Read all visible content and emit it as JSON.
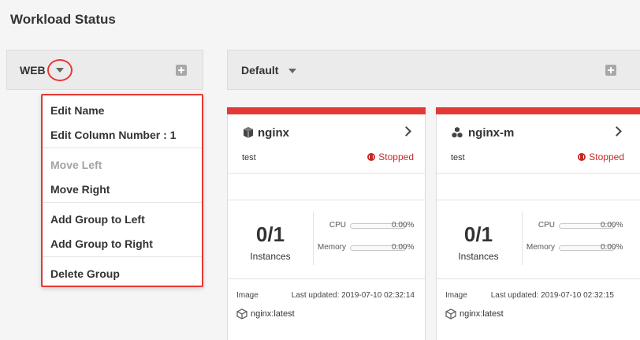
{
  "page": {
    "title": "Workload Status"
  },
  "groups": [
    {
      "name": "WEB"
    },
    {
      "name": "Default"
    }
  ],
  "menu": {
    "items": [
      {
        "label": "Edit Name",
        "disabled": false
      },
      {
        "label": "Edit Column Number : 1",
        "disabled": false
      },
      {
        "label": "Move Left",
        "disabled": true
      },
      {
        "label": "Move Right",
        "disabled": false
      },
      {
        "label": "Add Group to Left",
        "disabled": false
      },
      {
        "label": "Add Group to Right",
        "disabled": false
      },
      {
        "label": "Delete Group",
        "disabled": false
      }
    ]
  },
  "workloads": [
    {
      "name": "nginx",
      "icon": "cube-icon",
      "description": "test",
      "status": "Stopped",
      "instances": "0/1",
      "instances_label": "Instances",
      "cpu_label": "CPU",
      "cpu_value": "0.00%",
      "cpu_fraction": 0,
      "memory_label": "Memory",
      "memory_value": "0.00%",
      "memory_fraction": 0,
      "image_label": "Image",
      "last_updated": "Last updated: 2019-07-10 02:32:14",
      "image_name": "nginx:latest"
    },
    {
      "name": "nginx-m",
      "icon": "cubes-icon",
      "description": "test",
      "status": "Stopped",
      "instances": "0/1",
      "instances_label": "Instances",
      "cpu_label": "CPU",
      "cpu_value": "0.00%",
      "cpu_fraction": 0,
      "memory_label": "Memory",
      "memory_value": "0.00%",
      "memory_fraction": 0,
      "image_label": "Image",
      "last_updated": "Last updated: 2019-07-10 02:32:15",
      "image_name": "nginx:latest"
    }
  ],
  "colors": {
    "accent_red": "#e53935",
    "status_stopped": "#c62828"
  }
}
